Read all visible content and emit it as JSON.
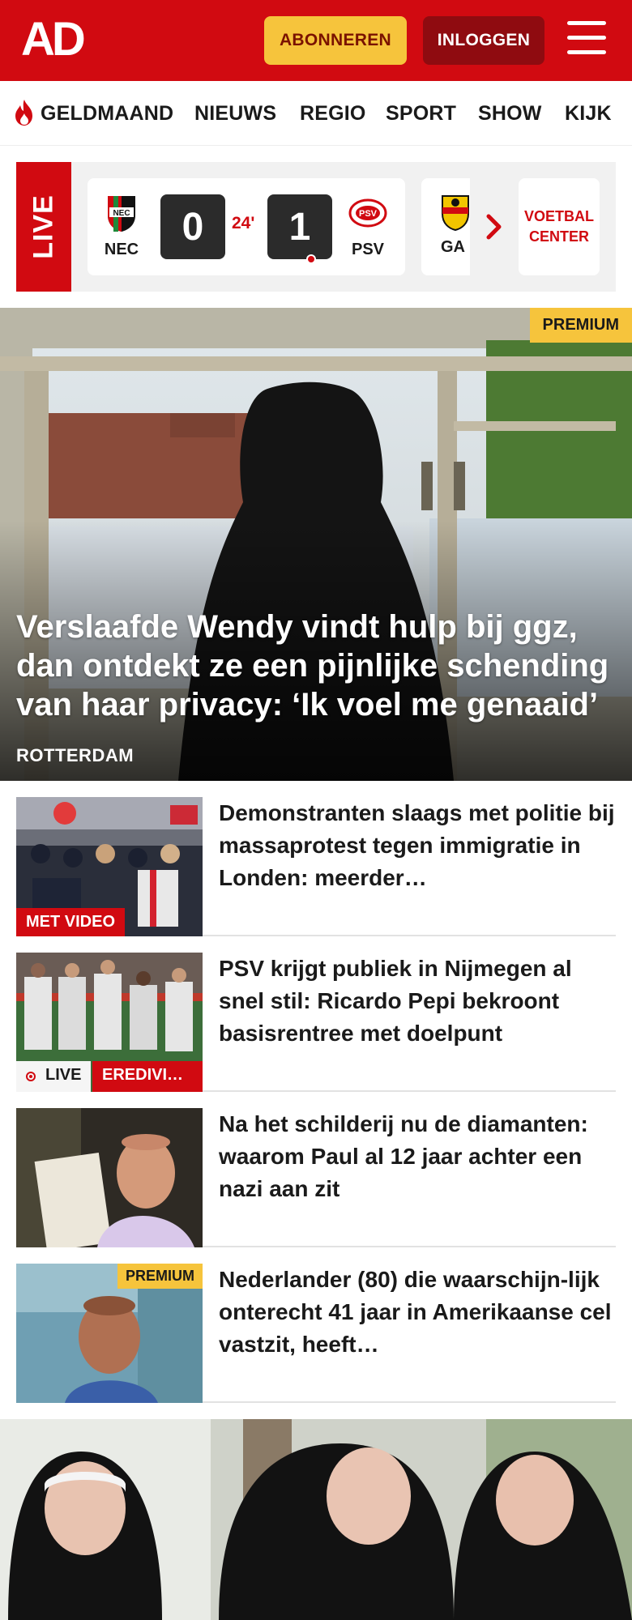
{
  "header": {
    "logo": "AD",
    "subscribe_label": "ABONNEREN",
    "login_label": "INLOGGEN",
    "brand_color": "#d10a11"
  },
  "nav": {
    "items": [
      "GELDMAAND",
      "NIEUWS",
      "REGIO",
      "SPORT",
      "SHOW",
      "KIJK"
    ]
  },
  "live": {
    "tag": "LIVE",
    "match": {
      "home": "NEC",
      "home_score": "0",
      "minute": "24'",
      "away_score": "1",
      "away": "PSV"
    },
    "next_match_team": "GA",
    "voetbal_center": "VOETBAL CENTER"
  },
  "hero": {
    "badge": "PREMIUM",
    "title": "Verslaafde Wendy vindt hulp bij ggz, dan ontdekt ze een pijnlijke schending van haar privacy: ‘Ik voel me genaaid’",
    "location": "ROTTERDAM"
  },
  "articles": [
    {
      "title": "Demonstranten slaags met politie bij massaprotest tegen immigratie in Londen: meerder…",
      "label": "MET VIDEO"
    },
    {
      "title": "PSV krijgt publiek in Nijmegen al snel stil: Ricardo Pepi bekroont basisrentree met doelpunt",
      "live_label": "LIVE",
      "category": "EREDIVI…"
    },
    {
      "title": "Na het schilderij nu de diamanten: waarom Paul al 12 jaar achter een nazi aan zit"
    },
    {
      "title": "Nederlander (80) die waarschijn-lijk onterecht 41 jaar in Amerikaanse cel vastzit, heeft…",
      "badge": "PREMIUM"
    }
  ]
}
